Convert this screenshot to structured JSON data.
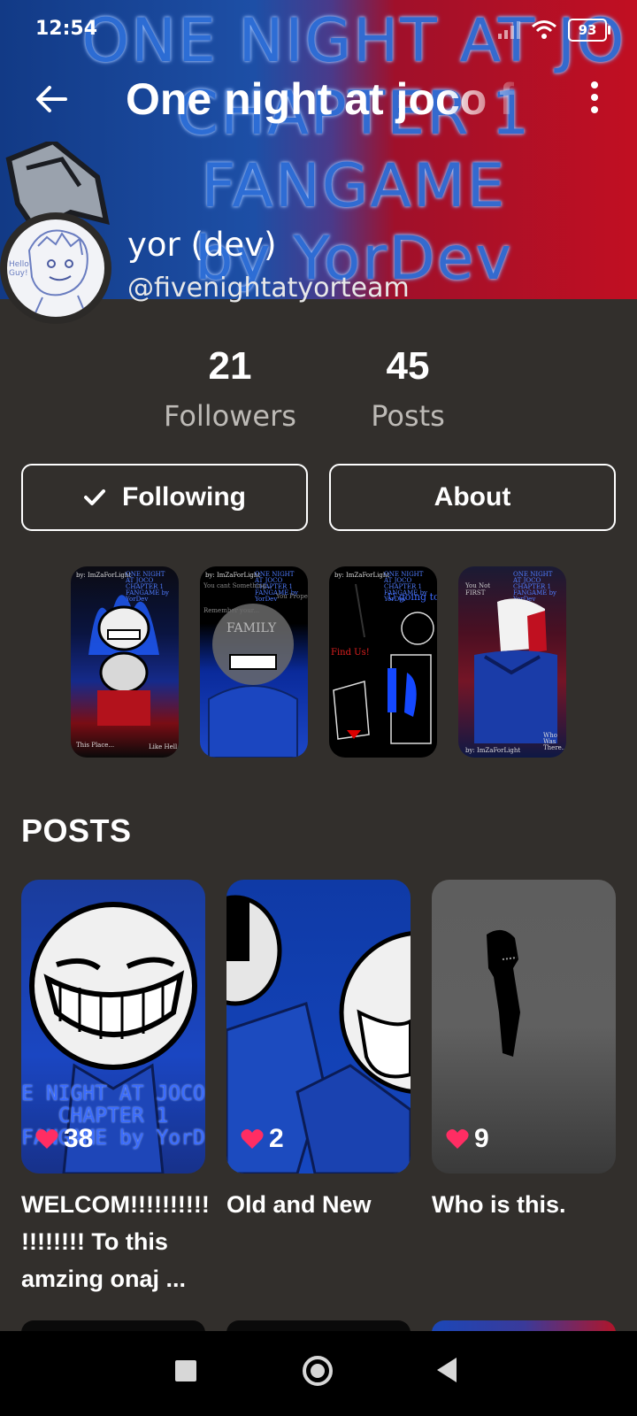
{
  "status_bar": {
    "time": "12:54",
    "battery": "93"
  },
  "header": {
    "title": "One night at joco f"
  },
  "banner": {
    "lines": [
      "ONE NIGHT AT JO",
      "CHAPTER 1",
      "FANGAME",
      "by YorDev"
    ]
  },
  "profile": {
    "username": "yor (dev)",
    "handle": "@fivenightatyorteam",
    "avatar_text": "Hello Guy!",
    "followers_count": "21",
    "followers_label": "Followers",
    "posts_count": "45",
    "posts_label": "Posts"
  },
  "actions": {
    "following_label": "Following",
    "about_label": "About"
  },
  "covers": [
    {
      "top_left": "by: ImZaForLight",
      "top_right": "ONE NIGHT AT JOCO CHAPTER 1 FANGAME by YorDev",
      "bottom_left": "This Place...",
      "bottom_right": "Like Hell"
    },
    {
      "top_left": "by: ImZaForLight",
      "top_right": "ONE NIGHT AT JOCO CHAPTER 1 FANGAME by YorDev",
      "line1": "You cant Something...",
      "line2": "You Proper it...",
      "line3": "Remember your...",
      "center": "FAMILY"
    },
    {
      "top_left": "by: ImZaForLight",
      "top_right": "ONE NIGHT AT JOCO CHAPTER 1 FANGAME by YorDev",
      "line1": "U going to",
      "line2": "Find Us!"
    },
    {
      "top_right": "ONE NIGHT AT JOCO CHAPTER 1 FANGAME by YorDev",
      "line1": "You Not FIRST",
      "bottom_left": "by: ImZaForLight",
      "bottom_right": "Who Was There..."
    }
  ],
  "posts_section": {
    "title": "POSTS",
    "items": [
      {
        "likes": "38",
        "title": "WELCOM!!!!!!!!!! !!!!!!!! To this amzing onaj ...",
        "overlay": [
          "E NIGHT AT JOCO",
          "CHAPTER 1",
          "FANGAME by YorD"
        ]
      },
      {
        "likes": "2",
        "title": "Old and New"
      },
      {
        "likes": "9",
        "title": "Who is this."
      }
    ]
  },
  "colors": {
    "background": "#322f2c",
    "heart": "#ff2d63",
    "muted_text": "#bdbab6"
  },
  "icons": [
    "back-arrow-icon",
    "more-vert-icon",
    "check-icon",
    "heart-icon",
    "wifi-icon",
    "signal-icon",
    "battery-icon",
    "nav-recent-icon",
    "nav-home-icon",
    "nav-back-icon"
  ]
}
